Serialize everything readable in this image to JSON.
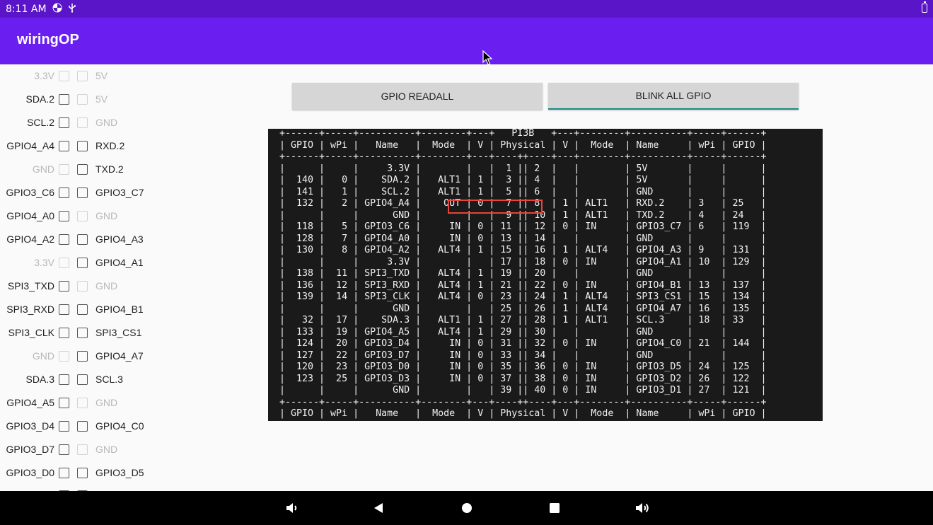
{
  "status_bar": {
    "time": "8:11 AM",
    "icons": [
      "pinwheel-icon",
      "usb-icon",
      "battery-icon"
    ]
  },
  "app": {
    "title": "wiringOP"
  },
  "left_panel": {
    "rows": [
      {
        "left": "3.3V",
        "left_enabled": false,
        "right": "5V",
        "right_enabled": false
      },
      {
        "left": "SDA.2",
        "left_enabled": true,
        "right": "5V",
        "right_enabled": false
      },
      {
        "left": "SCL.2",
        "left_enabled": true,
        "right": "GND",
        "right_enabled": false
      },
      {
        "left": "GPIO4_A4",
        "left_enabled": true,
        "right": "RXD.2",
        "right_enabled": true
      },
      {
        "left": "GND",
        "left_enabled": false,
        "right": "TXD.2",
        "right_enabled": true
      },
      {
        "left": "GPIO3_C6",
        "left_enabled": true,
        "right": "GPIO3_C7",
        "right_enabled": true
      },
      {
        "left": "GPIO4_A0",
        "left_enabled": true,
        "right": "GND",
        "right_enabled": false
      },
      {
        "left": "GPIO4_A2",
        "left_enabled": true,
        "right": "GPIO4_A3",
        "right_enabled": true
      },
      {
        "left": "3.3V",
        "left_enabled": false,
        "right": "GPIO4_A1",
        "right_enabled": true
      },
      {
        "left": "SPI3_TXD",
        "left_enabled": true,
        "right": "GND",
        "right_enabled": false
      },
      {
        "left": "SPI3_RXD",
        "left_enabled": true,
        "right": "GPIO4_B1",
        "right_enabled": true
      },
      {
        "left": "SPI3_CLK",
        "left_enabled": true,
        "right": "SPI3_CS1",
        "right_enabled": true
      },
      {
        "left": "GND",
        "left_enabled": false,
        "right": "GPIO4_A7",
        "right_enabled": true
      },
      {
        "left": "SDA.3",
        "left_enabled": true,
        "right": "SCL.3",
        "right_enabled": true
      },
      {
        "left": "GPIO4_A5",
        "left_enabled": true,
        "right": "GND",
        "right_enabled": false
      },
      {
        "left": "GPIO3_D4",
        "left_enabled": true,
        "right": "GPIO4_C0",
        "right_enabled": true
      },
      {
        "left": "GPIO3_D7",
        "left_enabled": true,
        "right": "GND",
        "right_enabled": false
      },
      {
        "left": "GPIO3_D0",
        "left_enabled": true,
        "right": "GPIO3_D5",
        "right_enabled": true
      },
      {
        "left": "",
        "left_enabled": true,
        "right": "",
        "right_enabled": true
      }
    ]
  },
  "buttons": {
    "readall": "GPIO READALL",
    "blink": "BLINK ALL GPIO"
  },
  "terminal": {
    "lines": [
      " +------+-----+----------+--------+---+   PI3B   +---+--------+----------+-----+------+",
      " | GPIO | wPi |   Name   |  Mode  | V | Physical | V |  Mode  | Name     | wPi | GPIO |",
      " +------+-----+----------+--------+---+----++----+---+--------+----------+-----+------+",
      " |      |     |     3.3V |        |   |  1 || 2  |   |        | 5V       |     |      |",
      " |  140 |   0 |    SDA.2 |   ALT1 | 1 |  3 || 4  |   |        | 5V       |     |      |",
      " |  141 |   1 |    SCL.2 |   ALT1 | 1 |  5 || 6  |   |        | GND      |     |      |",
      " |  132 |   2 | GPIO4_A4 |    OUT | 0 |  7 || 8  | 1 | ALT1   | RXD.2    | 3   | 25   |",
      " |      |     |      GND |        |   |  9 || 10 | 1 | ALT1   | TXD.2    | 4   | 24   |",
      " |  118 |   5 | GPIO3_C6 |     IN | 0 | 11 || 12 | 0 | IN     | GPIO3_C7 | 6   | 119  |",
      " |  128 |   7 | GPIO4_A0 |     IN | 0 | 13 || 14 |   |        | GND      |     |      |",
      " |  130 |   8 | GPIO4_A2 |   ALT4 | 1 | 15 || 16 | 1 | ALT4   | GPIO4_A3 | 9   | 131  |",
      " |      |     |     3.3V |        |   | 17 || 18 | 0 | IN     | GPIO4_A1 | 10  | 129  |",
      " |  138 |  11 | SPI3_TXD |   ALT4 | 1 | 19 || 20 |   |        | GND      |     |      |",
      " |  136 |  12 | SPI3_RXD |   ALT4 | 1 | 21 || 22 | 0 | IN     | GPIO4_B1 | 13  | 137  |",
      " |  139 |  14 | SPI3_CLK |   ALT4 | 0 | 23 || 24 | 1 | ALT4   | SPI3_CS1 | 15  | 134  |",
      " |      |     |      GND |        |   | 25 || 26 | 1 | ALT4   | GPIO4_A7 | 16  | 135  |",
      " |   32 |  17 |    SDA.3 |   ALT1 | 1 | 27 || 28 | 1 | ALT1   | SCL.3    | 18  | 33   |",
      " |  133 |  19 | GPIO4_A5 |   ALT4 | 1 | 29 || 30 |   |        | GND      |     |      |",
      " |  124 |  20 | GPIO3_D4 |     IN | 0 | 31 || 32 | 0 | IN     | GPIO4_C0 | 21  | 144  |",
      " |  127 |  22 | GPIO3_D7 |     IN | 0 | 33 || 34 |   |        | GND      |     |      |",
      " |  120 |  23 | GPIO3_D0 |     IN | 0 | 35 || 36 | 0 | IN     | GPIO3_D5 | 24  | 125  |",
      " |  123 |  25 | GPIO3_D3 |     IN | 0 | 37 || 38 | 0 | IN     | GPIO3_D2 | 26  | 122  |",
      " |      |     |      GND |        |   | 39 || 40 | 0 | IN     | GPIO3_D1 | 27  | 121  |",
      " +------+-----+----------+--------+---+----++----+---+--------+----------+-----+------+",
      " | GPIO | wPi |   Name   |  Mode  | V | Physical | V |  Mode  | Name     | wPi | GPIO |"
    ]
  },
  "colors": {
    "status_bar": "#5b15c9",
    "app_bar": "#6a1ef0",
    "highlight": "#e5453a",
    "blink_underline": "#1c8a84"
  },
  "nav_bar": {
    "items": [
      "volume-down-icon",
      "back-icon",
      "home-icon",
      "recents-icon",
      "volume-up-icon"
    ]
  }
}
